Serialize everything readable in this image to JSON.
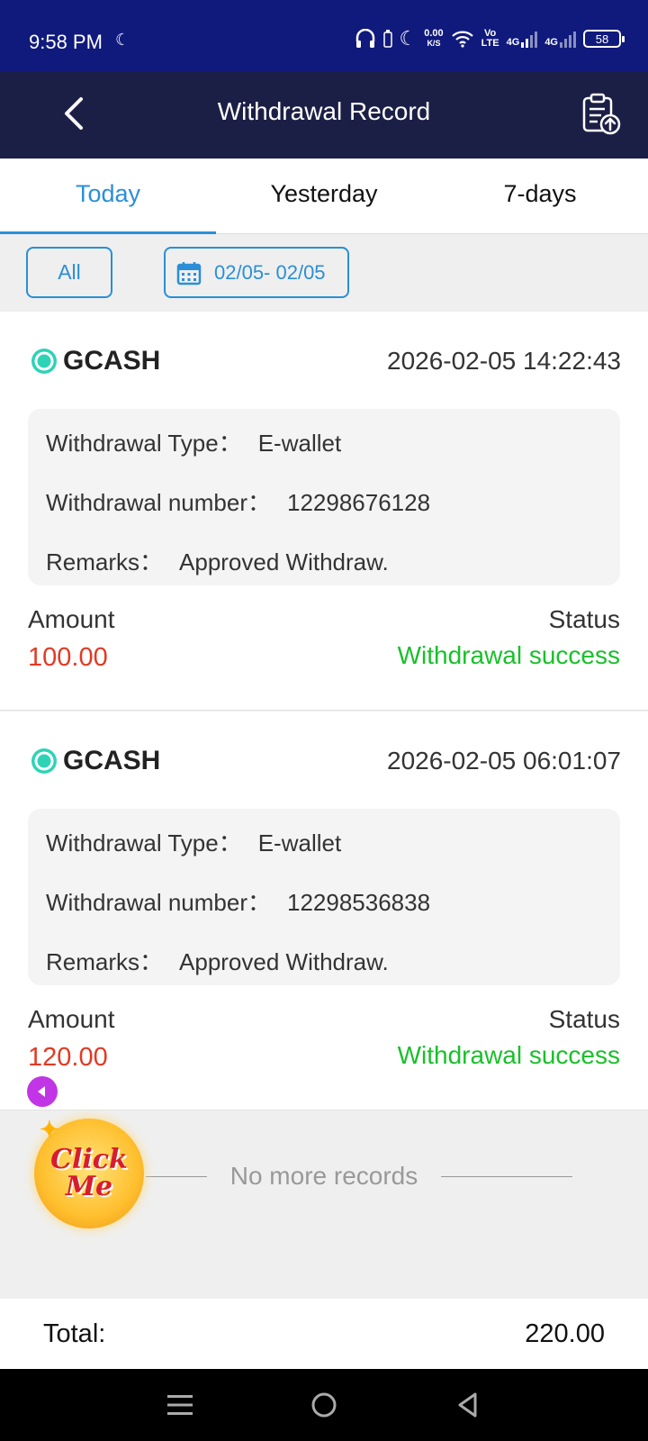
{
  "status_bar": {
    "time": "9:58 PM",
    "net_speed_value": "0.00",
    "net_speed_unit": "K/S",
    "volte_top": "Vo",
    "volte_bottom": "LTE",
    "sim1": "4G",
    "sim2": "4G",
    "battery": "58"
  },
  "header": {
    "title": "Withdrawal Record",
    "back_icon": "chevron-left-icon",
    "record_icon": "clipboard-upload-icon"
  },
  "tabs": [
    {
      "label": "Today",
      "active": true
    },
    {
      "label": "Yesterday",
      "active": false
    },
    {
      "label": "7-days",
      "active": false
    }
  ],
  "filters": {
    "all_label": "All",
    "date_range": "02/05- 02/05"
  },
  "labels": {
    "withdrawal_type": "Withdrawal Type：",
    "withdrawal_number": "Withdrawal number：",
    "remarks": "Remarks：",
    "amount": "Amount",
    "status": "Status"
  },
  "records": [
    {
      "brand": "GCASH",
      "datetime": "2026-02-05 14:22:43",
      "type": "E-wallet",
      "number": "12298676128",
      "remarks": "Approved Withdraw.",
      "amount": "100.00",
      "status": "Withdrawal success"
    },
    {
      "brand": "GCASH",
      "datetime": "2026-02-05 06:01:07",
      "type": "E-wallet",
      "number": "12298536838",
      "remarks": "Approved Withdraw.",
      "amount": "120.00",
      "status": "Withdrawal success"
    }
  ],
  "no_more": "No more records",
  "click_me": {
    "line1": "Click",
    "line2": "Me"
  },
  "total": {
    "label": "Total:",
    "value": "220.00"
  },
  "colors": {
    "status_bar": "#101a7c",
    "header": "#1c1f45",
    "accent": "#2a8fd6",
    "amount": "#e23a24",
    "success": "#19c02a"
  }
}
